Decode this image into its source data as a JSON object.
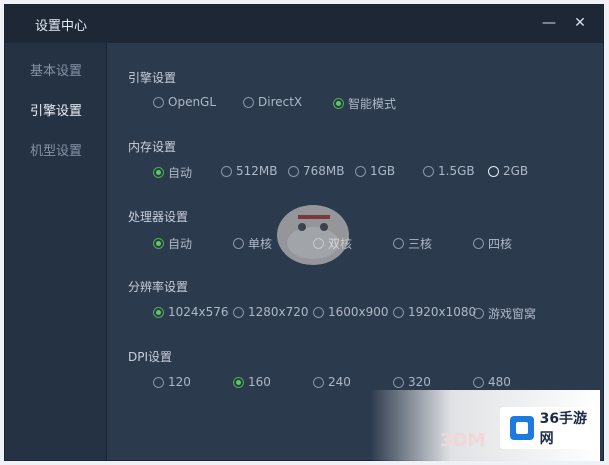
{
  "window": {
    "title": "设置中心",
    "min_glyph": "—",
    "close_glyph": "✕"
  },
  "sidebar": {
    "items": [
      {
        "label": "基本设置",
        "active": false
      },
      {
        "label": "引擎设置",
        "active": true
      },
      {
        "label": "机型设置",
        "active": false
      }
    ]
  },
  "sections": {
    "engine": {
      "title": "引擎设置",
      "options": [
        "OpenGL",
        "DirectX",
        "智能模式"
      ],
      "selected": "智能模式"
    },
    "memory": {
      "title": "内存设置",
      "options": [
        "自动",
        "512MB",
        "768MB",
        "1GB",
        "1.5GB",
        "2GB"
      ],
      "selected": "自动"
    },
    "cpu": {
      "title": "处理器设置",
      "options": [
        "自动",
        "单核",
        "双核",
        "三核",
        "四核"
      ],
      "selected": "自动"
    },
    "resolution": {
      "title": "分辨率设置",
      "options": [
        "1024x576",
        "1280x720",
        "1600x900",
        "1920x1080",
        "游戏窗窝"
      ],
      "selected": "1024x576"
    },
    "dpi": {
      "title": "DPI设置",
      "options": [
        "120",
        "160",
        "240",
        "320",
        "480"
      ],
      "selected": "160"
    }
  },
  "watermark": {
    "logo_text": "36手游网",
    "faint_text": "3DM"
  },
  "colors": {
    "window_bg": "#2c3a4d",
    "titlebar_bg": "#1d2736",
    "sidebar_bg": "#253244",
    "accent_green": "#5ccb5f"
  }
}
